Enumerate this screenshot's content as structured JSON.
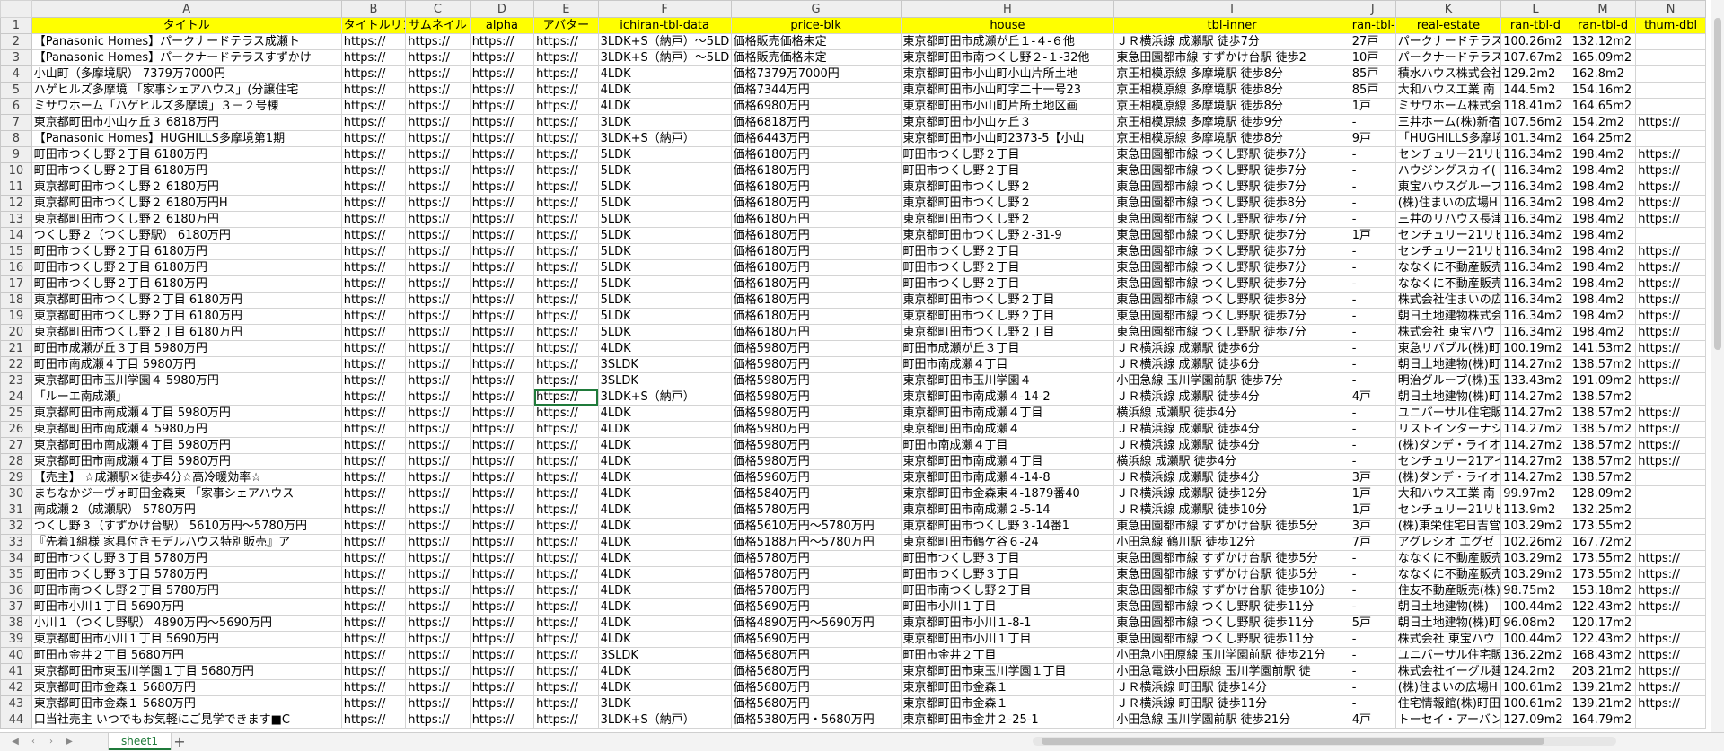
{
  "columns": [
    "A",
    "B",
    "C",
    "D",
    "E",
    "F",
    "G",
    "H",
    "I",
    "J",
    "K",
    "L",
    "M",
    "N"
  ],
  "header_row": [
    "タイトル",
    "タイトルリンク",
    "サムネイル",
    "alpha",
    "アバター",
    "ichiran-tbl-data",
    "price-blk",
    "house",
    "tbl-inner",
    "ran-tbl-d",
    "real-estate",
    "ran-tbl-d",
    "ran-tbl-d",
    "thum-dbl"
  ],
  "rows": [
    [
      "【Panasonic Homes】パークナードテラス成瀬ト",
      "https://",
      "https://",
      "https://",
      "https://",
      "3LDK+S（納戸）～5LD",
      "価格販売価格未定",
      "東京都町田市成瀬が丘１-４-６他",
      "ＪＲ横浜線 成瀬駅 徒歩7分",
      "27戸",
      "パークナードテラス",
      "100.26m2",
      "132.12m2",
      ""
    ],
    [
      "【Panasonic Homes】パークナードテラスすずかけ",
      "https://",
      "https://",
      "https://",
      "https://",
      "3LDK+S（納戸）～5LD",
      "価格販売価格未定",
      "東京都町田市南つくし野２-１-32他",
      "東急田園都市線 すずかけ台駅 徒歩2",
      "10戸",
      "パークナードテラス",
      "107.67m2",
      "165.09m2",
      ""
    ],
    [
      "小山町（多摩境駅） 7379万7000円",
      "https://",
      "https://",
      "https://",
      "https://",
      "4LDK",
      "価格7379万7000円",
      "東京都町田市小山町小山片所土地",
      "京王相模原線 多摩境駅 徒歩8分",
      "85戸",
      "積水ハウス株式会社",
      "129.2m2",
      "162.8m2",
      ""
    ],
    [
      "ハゲヒルズ多摩境 「家事シェアハウス」(分譲住宅",
      "https://",
      "https://",
      "https://",
      "https://",
      "4LDK",
      "価格7344万円",
      "東京都町田市小山町字二十一号23",
      "京王相模原線 多摩境駅 徒歩8分",
      "85戸",
      "大和ハウス工業 南",
      "144.5m2",
      "154.16m2",
      ""
    ],
    [
      "ミサワホーム「ハゲヒルズ多摩境」３－２号棟",
      "https://",
      "https://",
      "https://",
      "https://",
      "4LDK",
      "価格6980万円",
      "東京都町田市小山町片所土地区画",
      "京王相模原線 多摩境駅 徒歩8分",
      "1戸",
      "ミサワホーム株式会",
      "118.41m2",
      "164.65m2",
      ""
    ],
    [
      "東京都町田市小山ヶ丘３ 6818万円",
      "https://",
      "https://",
      "https://",
      "https://",
      "3LDK",
      "価格6818万円",
      "東京都町田市小山ヶ丘３",
      "京王相模原線 多摩境駅 徒歩9分",
      "-",
      "三井ホーム(株)新宿",
      "107.56m2",
      "154.2m2",
      "https://"
    ],
    [
      "【Panasonic Homes】HUGHILLS多摩境第1期",
      "https://",
      "https://",
      "https://",
      "https://",
      "3LDK+S（納戸）",
      "価格6443万円",
      "東京都町田市小山町2373-5【小山",
      "京王相模原線 多摩境駅 徒歩8分",
      "9戸",
      "「HUGHILLS多摩境」",
      "101.34m2",
      "164.25m2",
      ""
    ],
    [
      "町田市つくし野２丁目 6180万円",
      "https://",
      "https://",
      "https://",
      "https://",
      "5LDK",
      "価格6180万円",
      "町田市つくし野２丁目",
      "東急田園都市線 つくし野駅 徒歩7分",
      "-",
      "センチュリー21リビ",
      "116.34m2",
      "198.4m2",
      "https://"
    ],
    [
      "町田市つくし野２丁目 6180万円",
      "https://",
      "https://",
      "https://",
      "https://",
      "5LDK",
      "価格6180万円",
      "町田市つくし野２丁目",
      "東急田園都市線 つくし野駅 徒歩7分",
      "-",
      "ハウジングスカイ(",
      "116.34m2",
      "198.4m2",
      "https://"
    ],
    [
      "東京都町田市つくし野２ 6180万円",
      "https://",
      "https://",
      "https://",
      "https://",
      "5LDK",
      "価格6180万円",
      "東京都町田市つくし野２",
      "東急田園都市線 つくし野駅 徒歩7分",
      "-",
      "東宝ハウスグループ",
      "116.34m2",
      "198.4m2",
      "https://"
    ],
    [
      "東京都町田市つくし野２ 6180万円H",
      "https://",
      "https://",
      "https://",
      "https://",
      "5LDK",
      "価格6180万円",
      "東京都町田市つくし野２",
      "東急田園都市線 つくし野駅 徒歩8分",
      "-",
      "(株)住まいの広場H",
      "116.34m2",
      "198.4m2",
      "https://"
    ],
    [
      "東京都町田市つくし野２ 6180万円",
      "https://",
      "https://",
      "https://",
      "https://",
      "5LDK",
      "価格6180万円",
      "東京都町田市つくし野２",
      "東急田園都市線 つくし野駅 徒歩7分",
      "-",
      "三井のリハウス長津",
      "116.34m2",
      "198.4m2",
      "https://"
    ],
    [
      "つくし野２（つくし野駅） 6180万円",
      "https://",
      "https://",
      "https://",
      "https://",
      "5LDK",
      "価格6180万円",
      "東京都町田市つくし野２-31-9",
      "東急田園都市線 つくし野駅 徒歩7分",
      "1戸",
      "センチュリー21リビ",
      "116.34m2",
      "198.4m2",
      ""
    ],
    [
      "町田市つくし野２丁目 6180万円",
      "https://",
      "https://",
      "https://",
      "https://",
      "5LDK",
      "価格6180万円",
      "町田市つくし野２丁目",
      "東急田園都市線 つくし野駅 徒歩7分",
      "-",
      "センチュリー21リビ",
      "116.34m2",
      "198.4m2",
      "https://"
    ],
    [
      "町田市つくし野２丁目 6180万円",
      "https://",
      "https://",
      "https://",
      "https://",
      "5LDK",
      "価格6180万円",
      "町田市つくし野２丁目",
      "東急田園都市線 つくし野駅 徒歩7分",
      "-",
      "ななくに不動産販売",
      "116.34m2",
      "198.4m2",
      "https://"
    ],
    [
      "町田市つくし野２丁目 6180万円",
      "https://",
      "https://",
      "https://",
      "https://",
      "5LDK",
      "価格6180万円",
      "町田市つくし野２丁目",
      "東急田園都市線 つくし野駅 徒歩7分",
      "-",
      "ななくに不動産販売",
      "116.34m2",
      "198.4m2",
      "https://"
    ],
    [
      "東京都町田市つくし野２丁目 6180万円",
      "https://",
      "https://",
      "https://",
      "https://",
      "5LDK",
      "価格6180万円",
      "東京都町田市つくし野２丁目",
      "東急田園都市線 つくし野駅 徒歩8分",
      "-",
      "株式会社住まいの広",
      "116.34m2",
      "198.4m2",
      "https://"
    ],
    [
      "東京都町田市つくし野２丁目 6180万円",
      "https://",
      "https://",
      "https://",
      "https://",
      "5LDK",
      "価格6180万円",
      "東京都町田市つくし野２丁目",
      "東急田園都市線 つくし野駅 徒歩7分",
      "-",
      "朝日土地建物株式会",
      "116.34m2",
      "198.4m2",
      "https://"
    ],
    [
      "東京都町田市つくし野２丁目 6180万円",
      "https://",
      "https://",
      "https://",
      "https://",
      "5LDK",
      "価格6180万円",
      "東京都町田市つくし野２丁目",
      "東急田園都市線 つくし野駅 徒歩7分",
      "-",
      "株式会社 東宝ハウ",
      "116.34m2",
      "198.4m2",
      "https://"
    ],
    [
      "町田市成瀬が丘３丁目 5980万円",
      "https://",
      "https://",
      "https://",
      "https://",
      "4LDK",
      "価格5980万円",
      "町田市成瀬が丘３丁目",
      "ＪＲ横浜線 成瀬駅 徒歩6分",
      "-",
      "東急リバブル(株)町",
      "100.19m2",
      "141.53m2",
      "https://"
    ],
    [
      "町田市南成瀬４丁目 5980万円",
      "https://",
      "https://",
      "https://",
      "https://",
      "3SLDK",
      "価格5980万円",
      "町田市南成瀬４丁目",
      "ＪＲ横浜線 成瀬駅 徒歩6分",
      "-",
      "朝日土地建物(株)町",
      "114.27m2",
      "138.57m2",
      "https://"
    ],
    [
      "東京都町田市玉川学園４ 5980万円",
      "https://",
      "https://",
      "https://",
      "https://",
      "3SLDK",
      "価格5980万円",
      "東京都町田市玉川学園４",
      "小田急線 玉川学園前駅 徒歩7分",
      "-",
      "明治グループ(株)玉",
      "133.43m2",
      "191.09m2",
      "https://"
    ],
    [
      "「ルーエ南成瀬」",
      "https://",
      "https://",
      "https://",
      "https://",
      "3LDK+S（納戸）",
      "価格5980万円",
      "東京都町田市南成瀬４-14-2",
      "ＪＲ横浜線 成瀬駅 徒歩4分",
      "4戸",
      "朝日土地建物(株)町",
      "114.27m2",
      "138.57m2",
      ""
    ],
    [
      "東京都町田市南成瀬４丁目 5980万円",
      "https://",
      "https://",
      "https://",
      "https://",
      "4LDK",
      "価格5980万円",
      "東京都町田市南成瀬４丁目",
      "横浜線 成瀬駅 徒歩4分",
      "-",
      "ユニバーサル住宅販",
      "114.27m2",
      "138.57m2",
      "https://"
    ],
    [
      "東京都町田市南成瀬４ 5980万円",
      "https://",
      "https://",
      "https://",
      "https://",
      "4LDK",
      "価格5980万円",
      "東京都町田市南成瀬４",
      "ＪＲ横浜線 成瀬駅 徒歩4分",
      "-",
      "リストインターナシ",
      "114.27m2",
      "138.57m2",
      "https://"
    ],
    [
      "東京都町田市南成瀬４丁目 5980万円",
      "https://",
      "https://",
      "https://",
      "https://",
      "4LDK",
      "価格5980万円",
      "町田市南成瀬４丁目",
      "ＪＲ横浜線 成瀬駅 徒歩4分",
      "-",
      "(株)ダンデ・ライオ",
      "114.27m2",
      "138.57m2",
      "https://"
    ],
    [
      "東京都町田市南成瀬４丁目 5980万円",
      "https://",
      "https://",
      "https://",
      "https://",
      "4LDK",
      "価格5980万円",
      "東京都町田市南成瀬４丁目",
      "横浜線 成瀬駅 徒歩4分",
      "-",
      "センチュリー21アイ",
      "114.27m2",
      "138.57m2",
      "https://"
    ],
    [
      "【売主】 ☆成瀬駅×徒歩4分☆高冷暖効率☆",
      "https://",
      "https://",
      "https://",
      "https://",
      "4LDK",
      "価格5960万円",
      "東京都町田市南成瀬４-14-8",
      "ＪＲ横浜線 成瀬駅 徒歩4分",
      "3戸",
      "(株)ダンデ・ライオ",
      "114.27m2",
      "138.57m2",
      ""
    ],
    [
      "まちなかジーヴォ町田金森東 「家事シェアハウス",
      "https://",
      "https://",
      "https://",
      "https://",
      "4LDK",
      "価格5840万円",
      "東京都町田市金森東４-1879番40",
      "ＪＲ横浜線 成瀬駅 徒歩12分",
      "1戸",
      "大和ハウス工業 南",
      "99.97m2",
      "128.09m2",
      ""
    ],
    [
      "南成瀬２（成瀬駅） 5780万円",
      "https://",
      "https://",
      "https://",
      "https://",
      "4LDK",
      "価格5780万円",
      "東京都町田市南成瀬２-5-14",
      "ＪＲ横浜線 成瀬駅 徒歩10分",
      "1戸",
      "センチュリー21リビ",
      "113.9m2",
      "132.25m2",
      ""
    ],
    [
      "つくし野３（すずかけ台駅） 5610万円～5780万円",
      "https://",
      "https://",
      "https://",
      "https://",
      "4LDK",
      "価格5610万円～5780万円",
      "東京都町田市つくし野３-14番1",
      "東急田園都市線 すずかけ台駅 徒歩5分",
      "3戸",
      "(株)東栄住宅日吉営",
      "103.29m2",
      "173.55m2",
      ""
    ],
    [
      "『先着1組様 家具付きモデルハウス特別販売』ア",
      "https://",
      "https://",
      "https://",
      "https://",
      "4LDK",
      "価格5188万円～5780万円",
      "東京都町田市鶴ケ谷６-24",
      "小田急線 鶴川駅 徒歩12分",
      "7戸",
      "アグレシオ エグゼ",
      "102.26m2",
      "167.72m2",
      ""
    ],
    [
      "町田市つくし野３丁目 5780万円",
      "https://",
      "https://",
      "https://",
      "https://",
      "4LDK",
      "価格5780万円",
      "町田市つくし野３丁目",
      "東急田園都市線 すずかけ台駅 徒歩5分",
      "-",
      "ななくに不動産販売",
      "103.29m2",
      "173.55m2",
      "https://"
    ],
    [
      "町田市つくし野３丁目 5780万円",
      "https://",
      "https://",
      "https://",
      "https://",
      "4LDK",
      "価格5780万円",
      "町田市つくし野３丁目",
      "東急田園都市線 すずかけ台駅 徒歩5分",
      "-",
      "ななくに不動産販売",
      "103.29m2",
      "173.55m2",
      "https://"
    ],
    [
      "町田市南つくし野２丁目 5780万円",
      "https://",
      "https://",
      "https://",
      "https://",
      "4LDK",
      "価格5780万円",
      "町田市南つくし野２丁目",
      "東急田園都市線 すずかけ台駅 徒歩10分",
      "-",
      "住友不動産販売(株)",
      "98.75m2",
      "153.18m2",
      "https://"
    ],
    [
      "町田市小川１丁目 5690万円",
      "https://",
      "https://",
      "https://",
      "https://",
      "4LDK",
      "価格5690万円",
      "町田市小川１丁目",
      "東急田園都市線 つくし野駅 徒歩11分",
      "-",
      "朝日土地建物(株)",
      "100.44m2",
      "122.43m2",
      "https://"
    ],
    [
      "小川１（つくし野駅） 4890万円～5690万円",
      "https://",
      "https://",
      "https://",
      "https://",
      "4LDK",
      "価格4890万円～5690万円",
      "東京都町田市小川１-8-1",
      "東急田園都市線 つくし野駅 徒歩11分",
      "5戸",
      "朝日土地建物(株)町",
      "96.08m2",
      "120.17m2",
      ""
    ],
    [
      "東京都町田市小川１丁目 5690万円",
      "https://",
      "https://",
      "https://",
      "https://",
      "4LDK",
      "価格5690万円",
      "東京都町田市小川１丁目",
      "東急田園都市線 つくし野駅 徒歩11分",
      "-",
      "株式会社 東宝ハウ",
      "100.44m2",
      "122.43m2",
      "https://"
    ],
    [
      "町田市金井２丁目 5680万円",
      "https://",
      "https://",
      "https://",
      "https://",
      "3SLDK",
      "価格5680万円",
      "町田市金井２丁目",
      "小田急小田原線 玉川学園前駅 徒歩21分",
      "-",
      "ユニバーサル住宅販",
      "136.22m2",
      "168.43m2",
      "https://"
    ],
    [
      "東京都町田市東玉川学園１丁目 5680万円",
      "https://",
      "https://",
      "https://",
      "https://",
      "4LDK",
      "価格5680万円",
      "東京都町田市東玉川学園１丁目",
      "小田急電鉄小田原線 玉川学園前駅 徒",
      "-",
      "株式会社イーグル建",
      "124.2m2",
      "203.21m2",
      "https://"
    ],
    [
      "東京都町田市金森１ 5680万円",
      "https://",
      "https://",
      "https://",
      "https://",
      "4LDK",
      "価格5680万円",
      "東京都町田市金森１",
      "ＪＲ横浜線 町田駅 徒歩14分",
      "-",
      "(株)住まいの広場H",
      "100.61m2",
      "139.21m2",
      "https://"
    ],
    [
      "東京都町田市金森１ 5680万円",
      "https://",
      "https://",
      "https://",
      "https://",
      "3LDK",
      "価格5680万円",
      "東京都町田市金森１",
      "ＪＲ横浜線 町田駅 徒歩11分",
      "-",
      "住宅情報館(株)町田",
      "100.61m2",
      "139.21m2",
      "https://"
    ],
    [
      "口当社売主 いつでもお気軽にご見学できます■C",
      "https://",
      "https://",
      "https://",
      "https://",
      "3LDK+S（納戸）",
      "価格5380万円・5680万円",
      "東京都町田市金井２-25-1",
      "小田急線 玉川学園前駅 徒歩21分",
      "4戸",
      "トーセイ・アーバン",
      "127.09m2",
      "164.79m2",
      ""
    ]
  ],
  "selected_cell": "E24",
  "sheet_tab": "sheet1",
  "add_sheet": "+"
}
